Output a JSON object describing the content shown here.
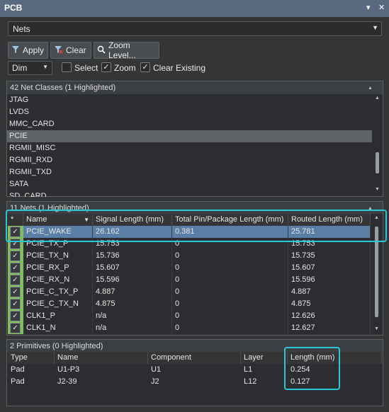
{
  "window": {
    "title": "PCB",
    "menu_icon": "chevron-down-icon",
    "close_icon": "close-icon"
  },
  "mode_combo": {
    "value": "Nets"
  },
  "toolbar": {
    "apply_label": "Apply",
    "clear_label": "Clear",
    "zoom_level_label": "Zoom Level..."
  },
  "options": {
    "dim_value": "Dim",
    "select_label": "Select",
    "select_checked": false,
    "zoom_label": "Zoom",
    "zoom_checked": true,
    "clear_existing_label": "Clear Existing",
    "clear_existing_checked": true
  },
  "net_classes": {
    "header": "42 Net Classes (1 Highlighted)",
    "items": [
      "JTAG",
      "LVDS",
      "MMC_CARD",
      "PCIE",
      "RGMII_MISC",
      "RGMII_RXD",
      "RGMII_TXD",
      "SATA",
      "SD_CARD"
    ],
    "selected_index": 3
  },
  "nets": {
    "header": "11 Nets (1 Highlighted)",
    "columns": [
      "*",
      "Name",
      "Signal Length (mm)",
      "Total Pin/Package Length (mm)",
      "Routed Length (mm)"
    ],
    "rows": [
      {
        "name": "PCIE_WAKE",
        "signal": "26.162",
        "pin": "0.381",
        "routed": "25.781",
        "selected": true
      },
      {
        "name": "PCIE_TX_P",
        "signal": "15.753",
        "pin": "0",
        "routed": "15.753"
      },
      {
        "name": "PCIE_TX_N",
        "signal": "15.736",
        "pin": "0",
        "routed": "15.735"
      },
      {
        "name": "PCIE_RX_P",
        "signal": "15.607",
        "pin": "0",
        "routed": "15.607"
      },
      {
        "name": "PCIE_RX_N",
        "signal": "15.596",
        "pin": "0",
        "routed": "15.596"
      },
      {
        "name": "PCIE_C_TX_P",
        "signal": "4.887",
        "pin": "0",
        "routed": "4.887"
      },
      {
        "name": "PCIE_C_TX_N",
        "signal": "4.875",
        "pin": "0",
        "routed": "4.875"
      },
      {
        "name": "CLK1_P",
        "signal": "n/a",
        "pin": "0",
        "routed": "12.626"
      },
      {
        "name": "CLK1_N",
        "signal": "n/a",
        "pin": "0",
        "routed": "12.627"
      }
    ]
  },
  "primitives": {
    "header": "2 Primitives (0 Highlighted)",
    "columns": [
      "Type",
      "Name",
      "Component",
      "Layer",
      "Length (mm)"
    ],
    "rows": [
      {
        "type": "Pad",
        "name": "U1-P3",
        "component": "U1",
        "layer": "L1",
        "length": "0.254"
      },
      {
        "type": "Pad",
        "name": "J2-39",
        "component": "J2",
        "layer": "L12",
        "length": "0.127"
      }
    ]
  },
  "colors": {
    "highlight_outline": "#29c8d2",
    "selected_row": "#5a7fa6",
    "title_bar": "#596a80"
  }
}
